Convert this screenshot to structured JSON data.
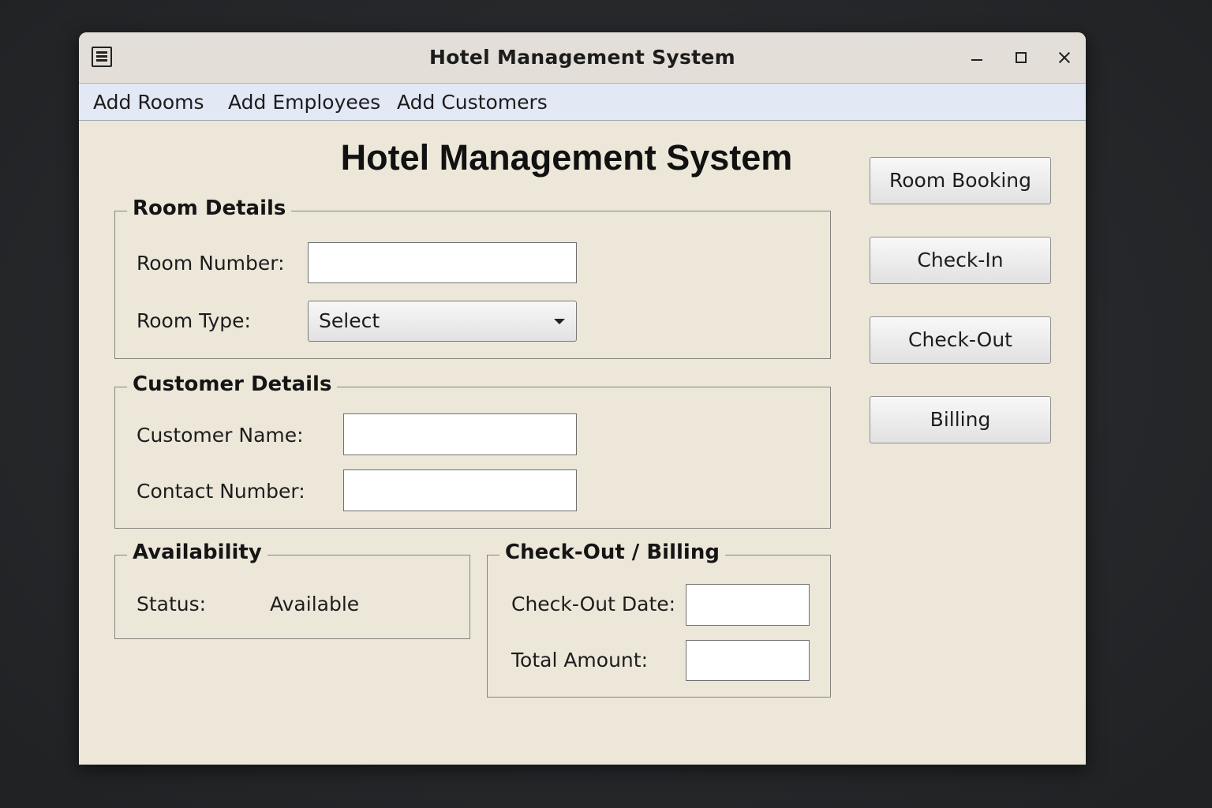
{
  "window": {
    "title": "Hotel Management System",
    "app_icon": "window-menu-icon"
  },
  "menu": [
    "Add Rooms",
    "Add Employees",
    "Add Customers"
  ],
  "heading": "Hotel Management System",
  "room_details": {
    "legend": "Room Details",
    "room_number_label": "Room Number:",
    "room_number_value": "",
    "room_type_label": "Room Type:",
    "room_type_value": "Select"
  },
  "customer_details": {
    "legend": "Customer Details",
    "customer_name_label": "Customer Name:",
    "customer_name_value": "",
    "contact_number_label": "Contact Number:",
    "contact_number_value": ""
  },
  "availability": {
    "legend": "Availability",
    "status_label": "Status:",
    "status_value": "Available"
  },
  "billing": {
    "legend": "Check-Out / Billing",
    "checkout_date_label": "Check-Out Date:",
    "checkout_date_value": "",
    "total_amount_label": "Total Amount:",
    "total_amount_value": ""
  },
  "actions": [
    "Room Booking",
    "Check-In",
    "Check-Out",
    "Billing"
  ]
}
